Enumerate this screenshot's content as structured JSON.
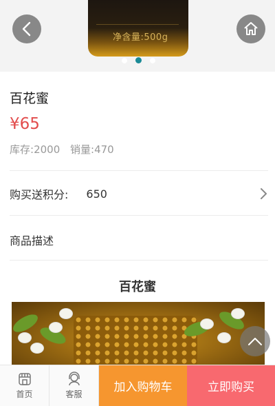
{
  "banner": {
    "jar_label": "净含量:500g",
    "slide_count": 3,
    "active_slide": 1
  },
  "product": {
    "name": "百花蜜",
    "price": "¥65",
    "stock_label": "库存:",
    "stock_value": "2000",
    "sales_label": "销量:",
    "sales_value": "470"
  },
  "points": {
    "label": "购买送积分:",
    "value": "650"
  },
  "description": {
    "label": "商品描述",
    "content_title": "百花蜜"
  },
  "bottom_bar": {
    "home_label": "首页",
    "service_label": "客服",
    "add_to_cart": "加入购物车",
    "buy_now": "立即购买"
  },
  "colors": {
    "price": "#e24c4c",
    "cart_button": "#f6962f",
    "buy_button": "#f8696f",
    "active_dot": "#1a8a96"
  },
  "icons": {
    "back": "chevron-left-icon",
    "home": "house-icon",
    "points_arrow": "chevron-right-icon",
    "scroll_top": "chevron-up-icon",
    "tab_home": "shop-icon",
    "tab_service": "headset-icon"
  }
}
